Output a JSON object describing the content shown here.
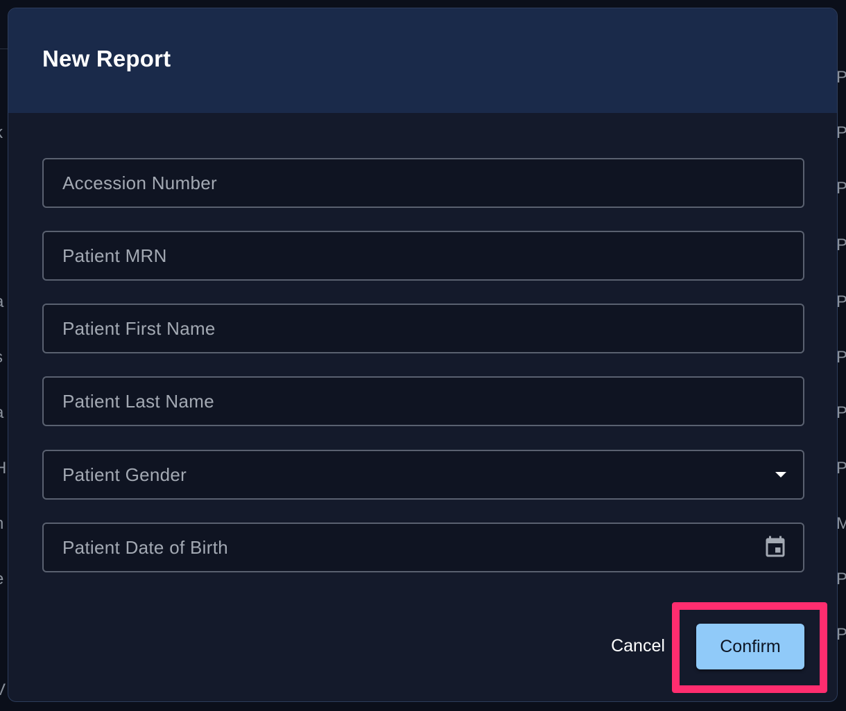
{
  "modal": {
    "title": "New Report"
  },
  "form": {
    "accession_number": {
      "placeholder": "Accession Number",
      "value": ""
    },
    "patient_mrn": {
      "placeholder": "Patient MRN",
      "value": ""
    },
    "patient_first_name": {
      "placeholder": "Patient First Name",
      "value": ""
    },
    "patient_last_name": {
      "placeholder": "Patient Last Name",
      "value": ""
    },
    "patient_gender": {
      "placeholder": "Patient Gender",
      "icon": "chevron-down-icon"
    },
    "patient_dob": {
      "placeholder": "Patient Date of Birth",
      "icon": "calendar-icon"
    }
  },
  "actions": {
    "cancel_label": "Cancel",
    "confirm_label": "Confirm"
  },
  "colors": {
    "header_bg": "#1a2a4a",
    "body_bg": "#141a2b",
    "confirm_bg": "#90caf9",
    "highlight": "#ff2d6f"
  }
}
